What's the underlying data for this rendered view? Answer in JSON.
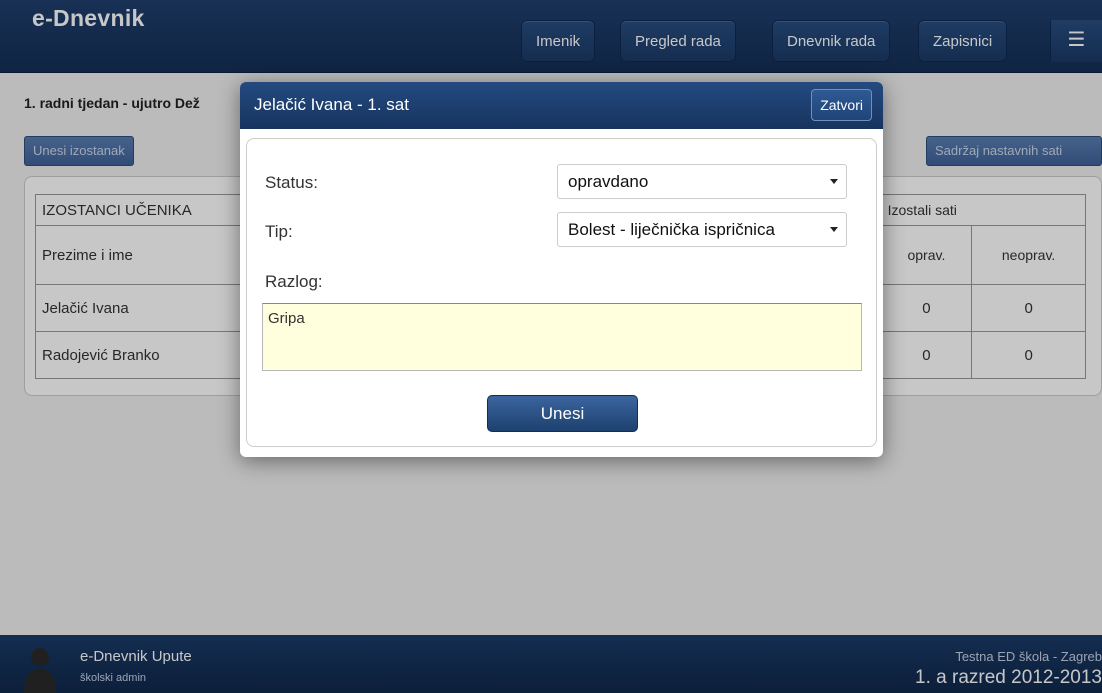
{
  "app": {
    "brand": "e-Dnevnik"
  },
  "nav": {
    "items": [
      "Imenik",
      "Pregled rada",
      "Dnevnik rada",
      "Zapisnici"
    ],
    "menu_icon": "hamburger-menu-icon"
  },
  "page": {
    "week_title": "1. radni tjedan - ujutro Dež",
    "add_absence_label": "Unesi izostanak",
    "lesson_content_label": "Sadržaj nastavnih sati"
  },
  "table": {
    "title": "IZOSTANCI UČENIKA",
    "name_header": "Prezime i ime",
    "hours_header": "Izostali sati",
    "col_excused": "oprav.",
    "col_unexcused": "neoprav.",
    "rows": [
      {
        "name": "Jelačić Ivana",
        "excused": "0",
        "unexcused": "0"
      },
      {
        "name": "Radojević Branko",
        "excused": "0",
        "unexcused": "0"
      }
    ]
  },
  "modal": {
    "title": "Jelačić Ivana - 1. sat",
    "close_label": "Zatvori",
    "status_label": "Status:",
    "status_value": "opravdano",
    "type_label": "Tip:",
    "type_value": "Bolest - liječnička ispričnica",
    "reason_label": "Razlog:",
    "reason_value": "Gripa",
    "submit_label": "Unesi"
  },
  "footer": {
    "title": "e-Dnevnik Upute",
    "role": "školski admin",
    "school": "Testna ED škola - Zagreb",
    "class": "1. a razred 2012-2013"
  }
}
